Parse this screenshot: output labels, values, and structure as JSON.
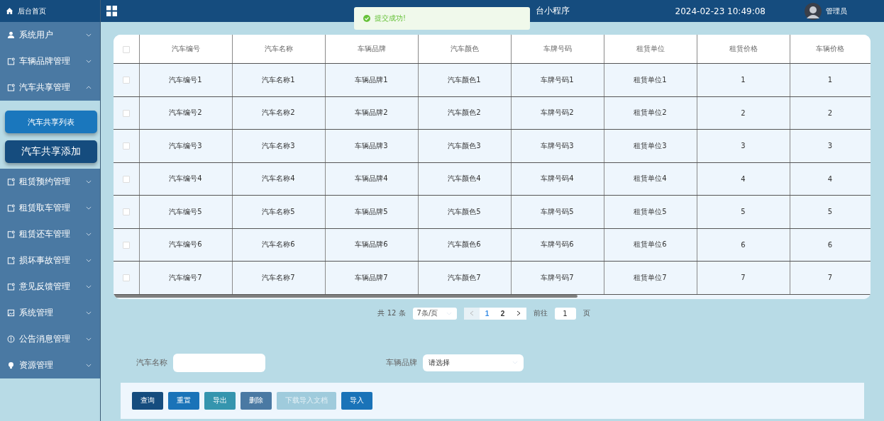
{
  "sidebar": {
    "home": {
      "label": "后台首页",
      "kind": "home"
    },
    "items": [
      {
        "label": "系统用户",
        "kind": "user",
        "expanded": false
      },
      {
        "label": "车辆品牌管理",
        "kind": "doc",
        "expanded": false
      },
      {
        "label": "汽车共享管理",
        "kind": "doc",
        "expanded": true,
        "children": [
          {
            "label": "汽车共享列表",
            "selected": true
          },
          {
            "label": "汽车共享添加",
            "selected": false
          }
        ]
      },
      {
        "label": "租赁预约管理",
        "kind": "doc",
        "expanded": false
      },
      {
        "label": "租赁取车管理",
        "kind": "doc",
        "expanded": false
      },
      {
        "label": "租赁还车管理",
        "kind": "doc",
        "expanded": false
      },
      {
        "label": "损坏事故管理",
        "kind": "doc",
        "expanded": false
      },
      {
        "label": "意见反馈管理",
        "kind": "doc",
        "expanded": false
      },
      {
        "label": "系统管理",
        "kind": "image",
        "expanded": false
      },
      {
        "label": "公告消息管理",
        "kind": "info",
        "expanded": false
      },
      {
        "label": "资源管理",
        "kind": "bulb",
        "expanded": false
      }
    ]
  },
  "header": {
    "title": "台小程序",
    "datetime": "2024-02-23 10:49:08",
    "user": "管理员"
  },
  "toast": {
    "message": "提交成功!"
  },
  "table": {
    "header_checked": false,
    "columns": [
      "汽车编号",
      "汽车名称",
      "车辆品牌",
      "汽车颜色",
      "车牌号码",
      "租赁单位",
      "租赁价格",
      "车辆价格"
    ],
    "rows": [
      {
        "checked": false,
        "cells": [
          "汽车编号1",
          "汽车名称1",
          "车辆品牌1",
          "汽车颜色1",
          "车牌号码1",
          "租赁单位1",
          "1",
          "1"
        ]
      },
      {
        "checked": false,
        "cells": [
          "汽车编号2",
          "汽车名称2",
          "车辆品牌2",
          "汽车颜色2",
          "车牌号码2",
          "租赁单位2",
          "2",
          "2"
        ]
      },
      {
        "checked": false,
        "cells": [
          "汽车编号3",
          "汽车名称3",
          "车辆品牌3",
          "汽车颜色3",
          "车牌号码3",
          "租赁单位3",
          "3",
          "3"
        ]
      },
      {
        "checked": false,
        "cells": [
          "汽车编号4",
          "汽车名称4",
          "车辆品牌4",
          "汽车颜色4",
          "车牌号码4",
          "租赁单位4",
          "4",
          "4"
        ]
      },
      {
        "checked": false,
        "cells": [
          "汽车编号5",
          "汽车名称5",
          "车辆品牌5",
          "汽车颜色5",
          "车牌号码5",
          "租赁单位5",
          "5",
          "5"
        ]
      },
      {
        "checked": false,
        "cells": [
          "汽车编号6",
          "汽车名称6",
          "车辆品牌6",
          "汽车颜色6",
          "车牌号码6",
          "租赁单位6",
          "6",
          "6"
        ]
      },
      {
        "checked": false,
        "cells": [
          "汽车编号7",
          "汽车名称7",
          "车辆品牌7",
          "汽车颜色7",
          "车牌号码7",
          "租赁单位7",
          "7",
          "7"
        ]
      }
    ]
  },
  "pagination": {
    "total": "共 12 条",
    "page_size": "7条/页",
    "prev_disabled": true,
    "pages": [
      {
        "label": "1",
        "selected": true
      },
      {
        "label": "2",
        "selected": false
      }
    ],
    "goto_label": "前往",
    "goto_value": "1",
    "goto_suffix": "页"
  },
  "search": {
    "fields": [
      {
        "kind": "input",
        "label": "汽车名称"
      },
      {
        "kind": "select",
        "label": "车辆品牌",
        "placeholder": "请选择"
      }
    ]
  },
  "buttons": [
    {
      "label": "查询",
      "color": "#154c7e",
      "disabled": false
    },
    {
      "label": "重置",
      "color": "#1a73b8",
      "disabled": false
    },
    {
      "label": "导出",
      "color": "#3595ae",
      "disabled": false
    },
    {
      "label": "删除",
      "color": "#4a79a3",
      "disabled": false
    },
    {
      "label": "下载导入文档",
      "color": "#9fcbdc",
      "disabled": true
    },
    {
      "label": "导入",
      "color": "#1a73b8",
      "disabled": false
    }
  ]
}
